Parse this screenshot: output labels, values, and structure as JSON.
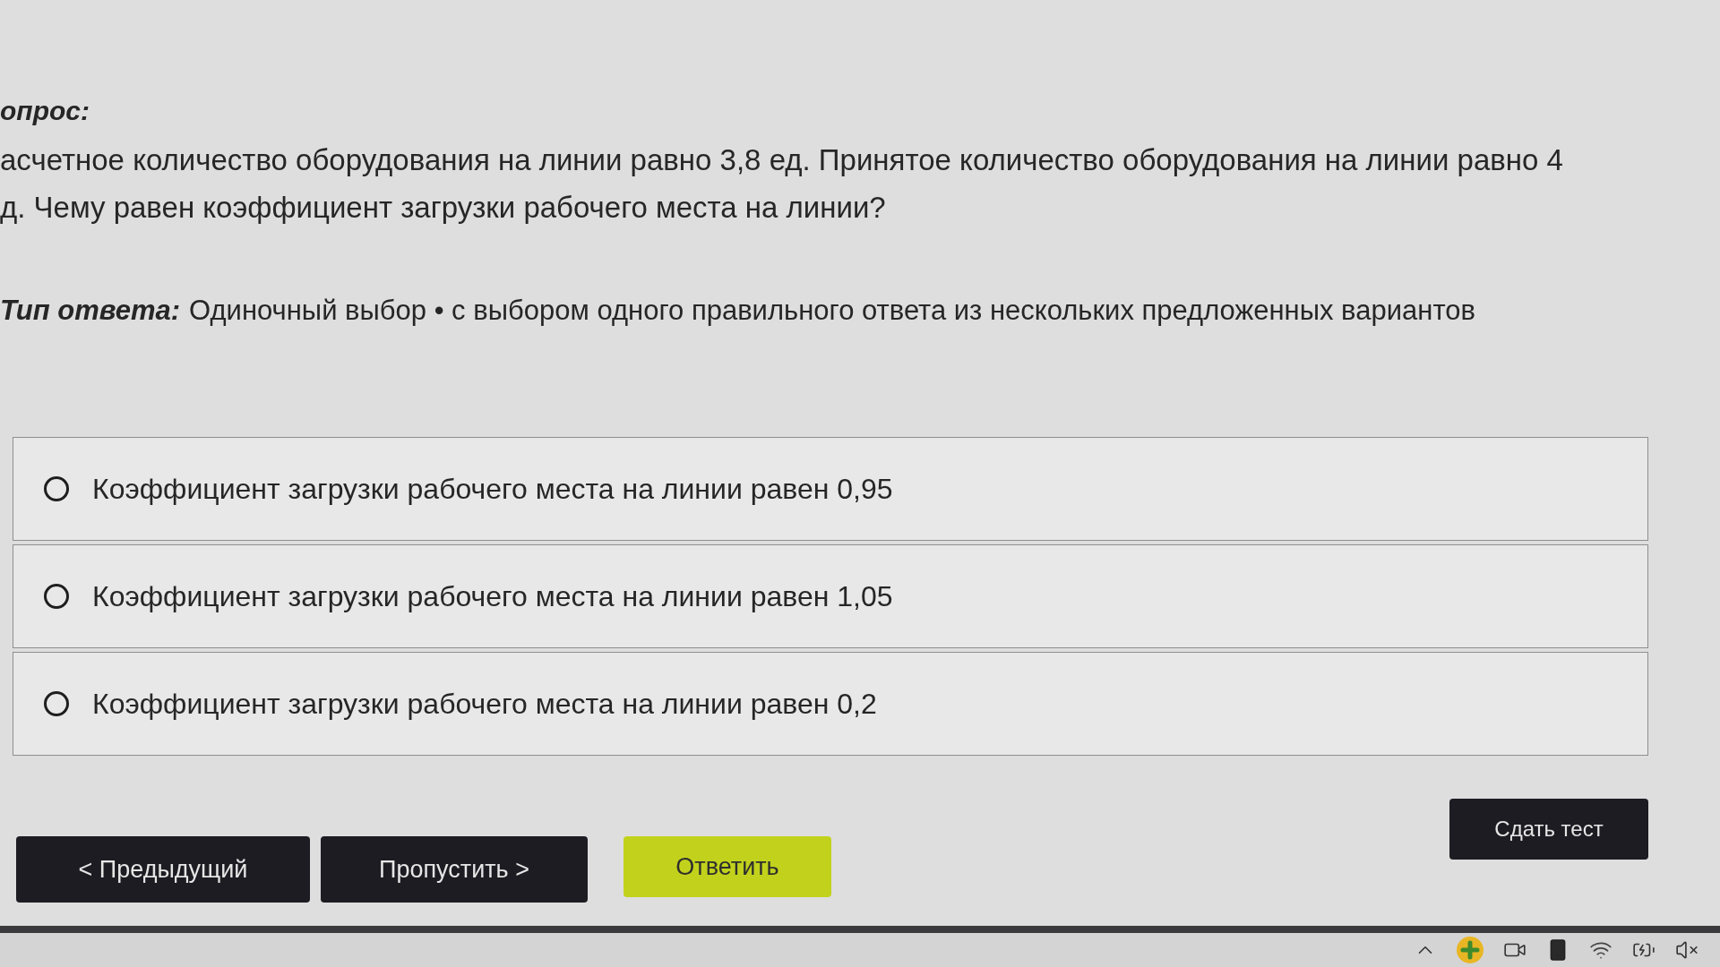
{
  "question": {
    "label": "опрос:",
    "lines": [
      "асчетное количество оборудования на линии равно 3,8 ед. Принятое количество оборудования на линии равно 4",
      "д. Чему равен коэффициент загрузки рабочего места на линии?"
    ]
  },
  "answer_type": {
    "label": "Тип ответа:",
    "value": "Одиночный выбор • с выбором одного правильного ответа из нескольких предложенных вариантов"
  },
  "options": [
    {
      "text": "Коэффициент загрузки рабочего места на линии равен 0,95",
      "selected": false
    },
    {
      "text": "Коэффициент загрузки рабочего места на линии равен 1,05",
      "selected": false
    },
    {
      "text": "Коэффициент загрузки рабочего места на линии равен 0,2",
      "selected": false
    }
  ],
  "nav_buttons": [
    {
      "label": "< Предыдущий",
      "kind": "dark"
    },
    {
      "label": "Пропустить >",
      "kind": "dark"
    },
    {
      "label": "Ответить",
      "kind": "accent"
    }
  ],
  "submit_button": {
    "label": "Сдать тест"
  }
}
